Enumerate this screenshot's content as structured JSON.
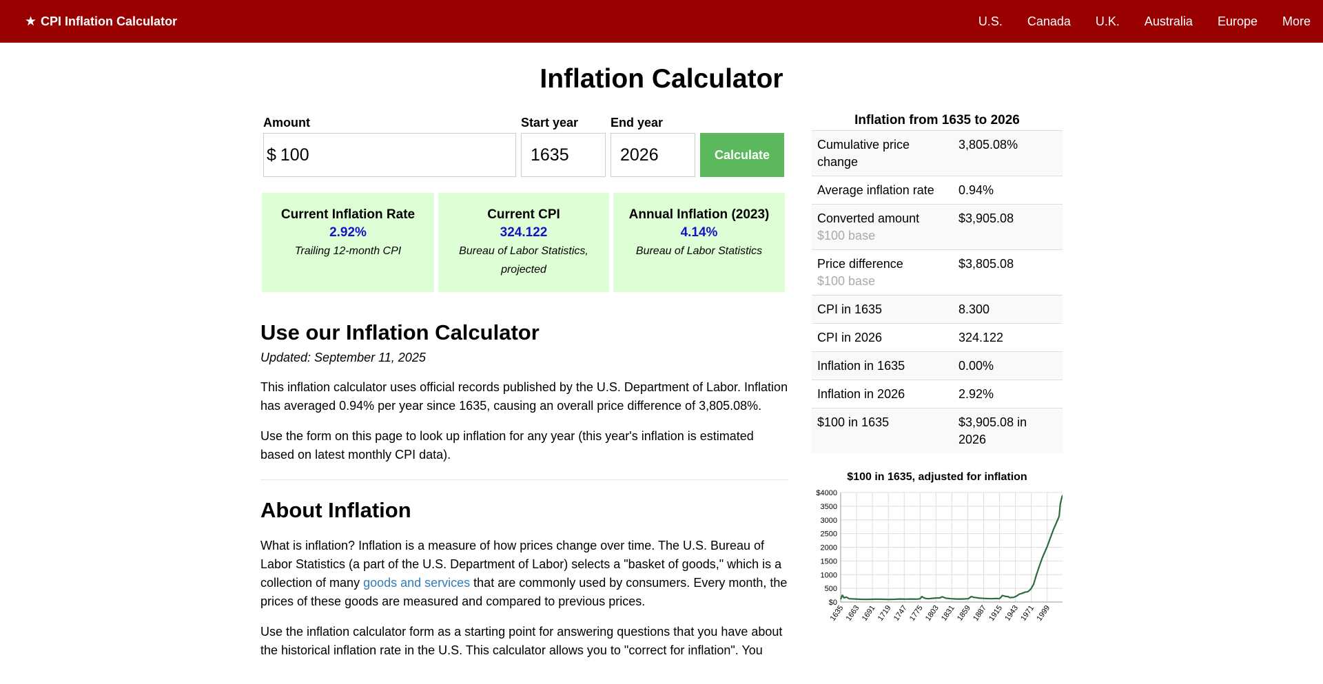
{
  "nav": {
    "brand": "CPI Inflation Calculator",
    "brand_icon": "star-icon",
    "links": [
      "U.S.",
      "Canada",
      "U.K.",
      "Australia",
      "Europe",
      "More"
    ]
  },
  "page_title": "Inflation Calculator",
  "form": {
    "amount_label": "Amount",
    "currency_symbol": "$",
    "amount_value": "100",
    "start_label": "Start year",
    "start_value": "1635",
    "end_label": "End year",
    "end_value": "2026",
    "button_label": "Calculate"
  },
  "stats": [
    {
      "title": "Current Inflation Rate",
      "value": "2.92%",
      "note": "Trailing 12-month CPI"
    },
    {
      "title": "Current CPI",
      "value": "324.122",
      "note": "Bureau of Labor Statistics, projected"
    },
    {
      "title": "Annual Inflation (2023)",
      "value": "4.14%",
      "note": "Bureau of Labor Statistics"
    }
  ],
  "article": {
    "heading": "Use our Inflation Calculator",
    "updated": "Updated: September 11, 2025",
    "p1": "This inflation calculator uses official records published by the U.S. Department of Labor. Inflation has averaged 0.94% per year since 1635, causing an overall price difference of 3,805.08%.",
    "p2": "Use the form on this page to look up inflation for any year (this year's inflation is estimated based on latest monthly CPI data).",
    "heading2": "About Inflation",
    "p3_before": "What is inflation? Inflation is a measure of how prices change over time. The U.S. Bureau of Labor Statistics (a part of the U.S. Department of Labor) selects a \"basket of goods,\" which is a collection of many ",
    "p3_link": "goods and services",
    "p3_after": " that are commonly used by consumers. Every month, the prices of these goods are measured and compared to previous prices.",
    "p4": "Use the inflation calculator form as a starting point for answering questions that you have about the historical inflation rate in the U.S. This calculator allows you to \"correct for inflation\". You"
  },
  "sidebar": {
    "title": "Inflation from 1635 to 2026",
    "rows": [
      {
        "key": "Cumulative price change",
        "value": "3,805.08%"
      },
      {
        "key": "Average inflation rate",
        "value": "0.94%"
      },
      {
        "key": "Converted amount",
        "sub": "$100 base",
        "value": "$3,905.08"
      },
      {
        "key": "Price difference",
        "sub": "$100 base",
        "value": "$3,805.08"
      },
      {
        "key": "CPI in 1635",
        "value": "8.300"
      },
      {
        "key": "CPI in 2026",
        "value": "324.122"
      },
      {
        "key": "Inflation in 1635",
        "value": "0.00%"
      },
      {
        "key": "Inflation in 2026",
        "value": "2.92%"
      },
      {
        "key": "$100 in 1635",
        "value": "$3,905.08 in 2026"
      }
    ]
  },
  "chart_data": {
    "type": "line",
    "title": "$100 in 1635, adjusted for inflation",
    "xlabel": "",
    "ylabel": "",
    "x_tick_labels": [
      "1635",
      "1663",
      "1691",
      "1719",
      "1747",
      "1775",
      "1803",
      "1831",
      "1859",
      "1887",
      "1915",
      "1943",
      "1971",
      "1999"
    ],
    "y_tick_labels": [
      "$0",
      "500",
      "1000",
      "1500",
      "2000",
      "2500",
      "3000",
      "3500",
      "$4000"
    ],
    "xlim": [
      1635,
      2026
    ],
    "ylim": [
      0,
      4000
    ],
    "grid": true,
    "line_color": "#2d6a3e",
    "series": [
      {
        "x": [
          1635,
          1638,
          1641,
          1645,
          1650,
          1660,
          1670,
          1680,
          1690,
          1700,
          1710,
          1720,
          1730,
          1740,
          1750,
          1760,
          1770,
          1775,
          1778,
          1781,
          1785,
          1790,
          1800,
          1810,
          1814,
          1820,
          1830,
          1840,
          1850,
          1860,
          1865,
          1870,
          1880,
          1890,
          1900,
          1910,
          1913,
          1916,
          1920,
          1925,
          1930,
          1933,
          1940,
          1945,
          1950,
          1955,
          1960,
          1965,
          1970,
          1975,
          1980,
          1985,
          1990,
          1995,
          2000,
          2005,
          2010,
          2015,
          2020,
          2022,
          2024,
          2026
        ],
        "y": [
          100,
          250,
          150,
          180,
          120,
          110,
          100,
          95,
          100,
          105,
          100,
          95,
          100,
          110,
          105,
          110,
          105,
          120,
          200,
          160,
          130,
          120,
          140,
          150,
          190,
          140,
          120,
          110,
          110,
          120,
          200,
          170,
          140,
          130,
          120,
          130,
          120,
          140,
          240,
          210,
          200,
          160,
          170,
          220,
          290,
          320,
          360,
          380,
          470,
          650,
          990,
          1300,
          1600,
          1840,
          2080,
          2370,
          2650,
          2880,
          3130,
          3570,
          3760,
          3905
        ]
      }
    ]
  }
}
